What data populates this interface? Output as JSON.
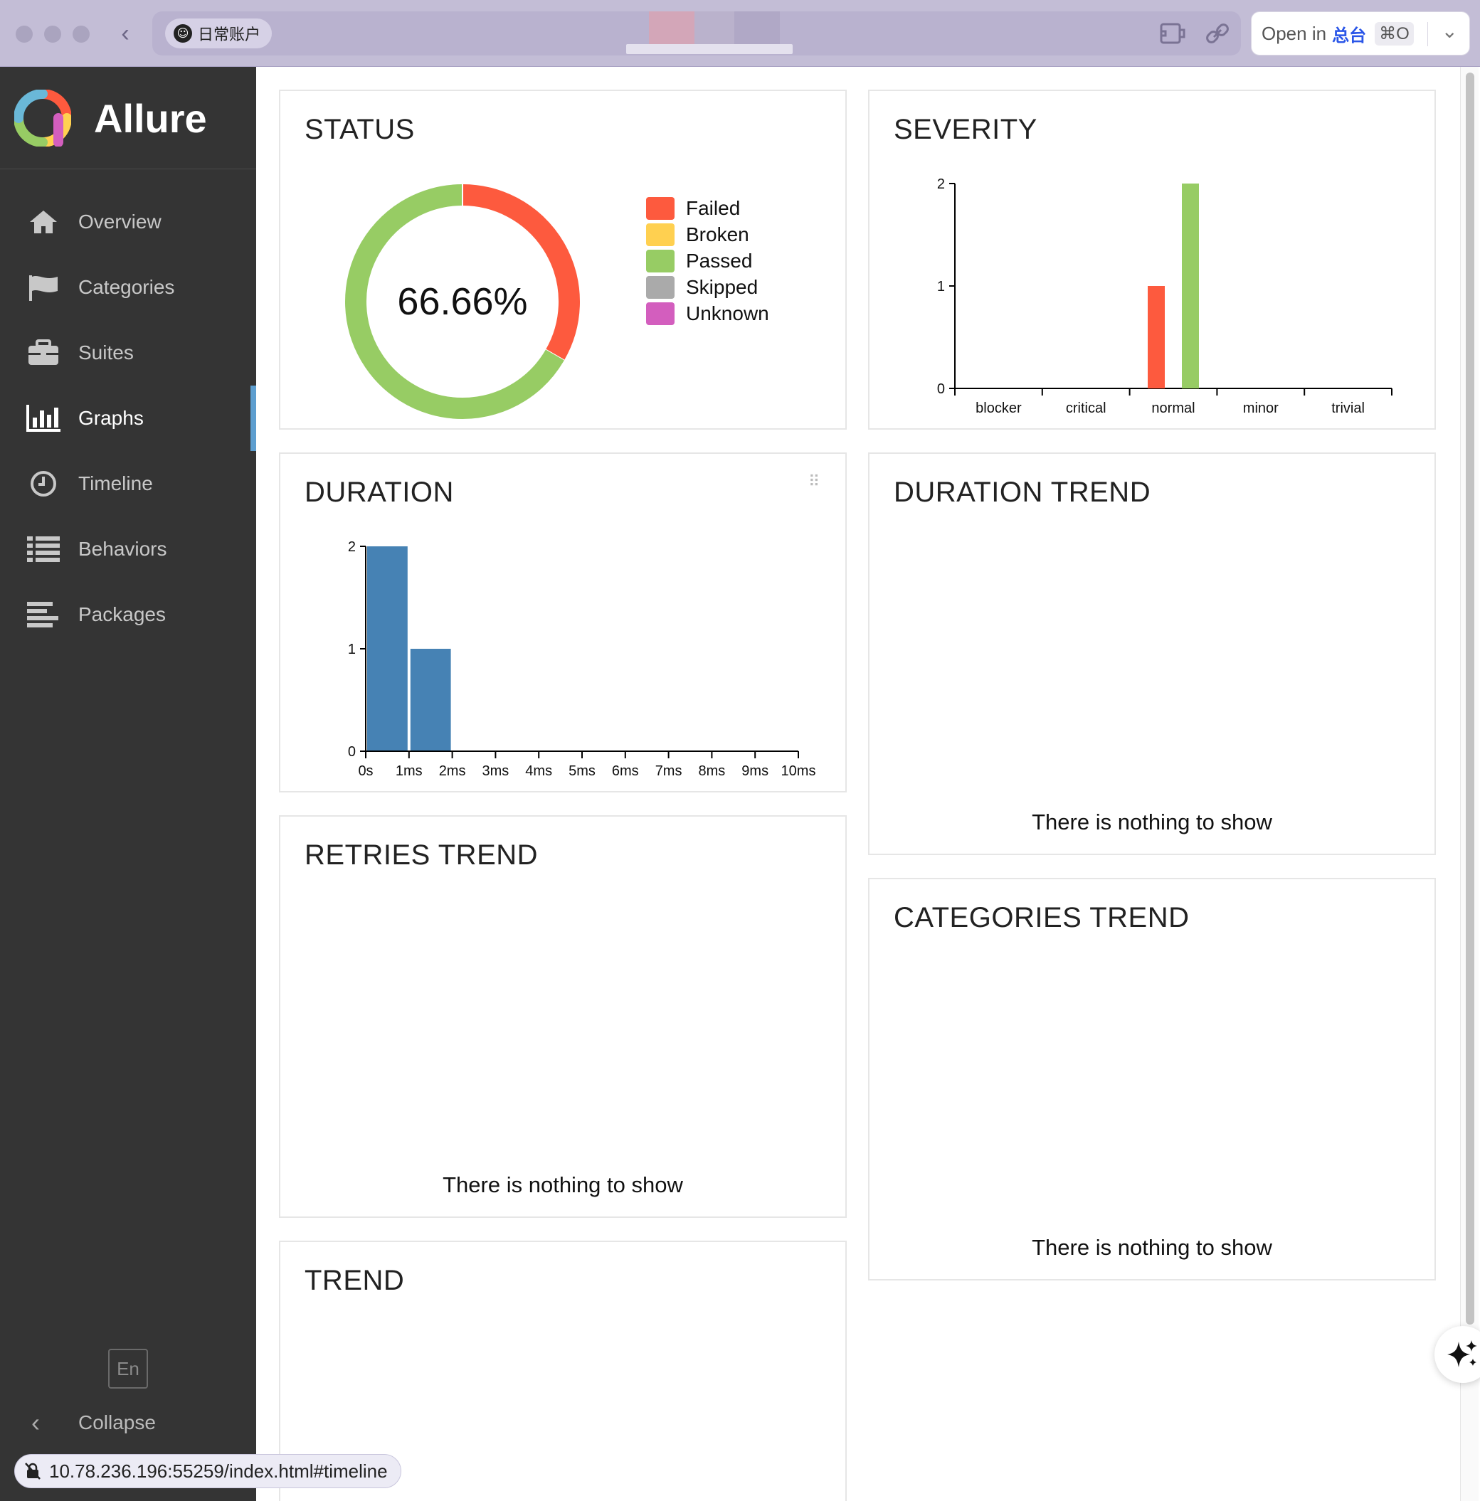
{
  "browser": {
    "site_name": "日常账户",
    "open_in_label": "Open in",
    "open_in_app": "总台",
    "shortcut": "⌘O",
    "status_url": "10.78.236.196:55259/index.html#timeline"
  },
  "sidebar": {
    "brand": "Allure",
    "items": [
      {
        "label": "Overview",
        "icon": "home-icon"
      },
      {
        "label": "Categories",
        "icon": "flag-icon"
      },
      {
        "label": "Suites",
        "icon": "briefcase-icon"
      },
      {
        "label": "Graphs",
        "icon": "bar-chart-icon",
        "active": true
      },
      {
        "label": "Timeline",
        "icon": "clock-icon"
      },
      {
        "label": "Behaviors",
        "icon": "list-icon"
      },
      {
        "label": "Packages",
        "icon": "align-left-icon"
      }
    ],
    "language": "En",
    "collapse_label": "Collapse"
  },
  "colors": {
    "failed": "#fd5a3e",
    "broken": "#ffd050",
    "passed": "#97cc64",
    "skipped": "#aaaaaa",
    "unknown": "#d35ebe",
    "duration_bar": "#4682b4",
    "active_accent": "#5d9ecf"
  },
  "panels": {
    "status": {
      "title": "STATUS"
    },
    "severity": {
      "title": "SEVERITY"
    },
    "duration": {
      "title": "DURATION"
    },
    "duration_trend": {
      "title": "DURATION TREND",
      "empty": "There is nothing to show"
    },
    "retries_trend": {
      "title": "RETRIES TREND",
      "empty": "There is nothing to show"
    },
    "categories_trend": {
      "title": "CATEGORIES TREND",
      "empty": "There is nothing to show"
    },
    "trend": {
      "title": "TREND"
    }
  },
  "chart_data": [
    {
      "type": "pie",
      "name": "status",
      "center_label": "66.66%",
      "categories": [
        "Failed",
        "Broken",
        "Passed",
        "Skipped",
        "Unknown"
      ],
      "values": [
        1,
        0,
        2,
        0,
        0
      ]
    },
    {
      "type": "bar",
      "name": "severity",
      "categories": [
        "blocker",
        "critical",
        "normal",
        "minor",
        "trivial"
      ],
      "series": [
        {
          "status": "failed",
          "values": [
            0,
            0,
            1,
            0,
            0
          ]
        },
        {
          "status": "passed",
          "values": [
            0,
            0,
            2,
            0,
            0
          ]
        }
      ],
      "y_ticks": [
        "0",
        "1",
        "2"
      ],
      "ylim": [
        0,
        2
      ]
    },
    {
      "type": "bar",
      "name": "duration",
      "bins": [
        [
          0,
          1
        ],
        [
          1,
          2
        ]
      ],
      "values": [
        2,
        1
      ],
      "x_ticks": [
        "0s",
        "1ms",
        "2ms",
        "3ms",
        "4ms",
        "5ms",
        "6ms",
        "7ms",
        "8ms",
        "9ms",
        "10ms"
      ],
      "xlim": [
        0,
        10
      ],
      "y_ticks": [
        "0",
        "1",
        "2"
      ],
      "ylim": [
        0,
        2
      ]
    }
  ]
}
